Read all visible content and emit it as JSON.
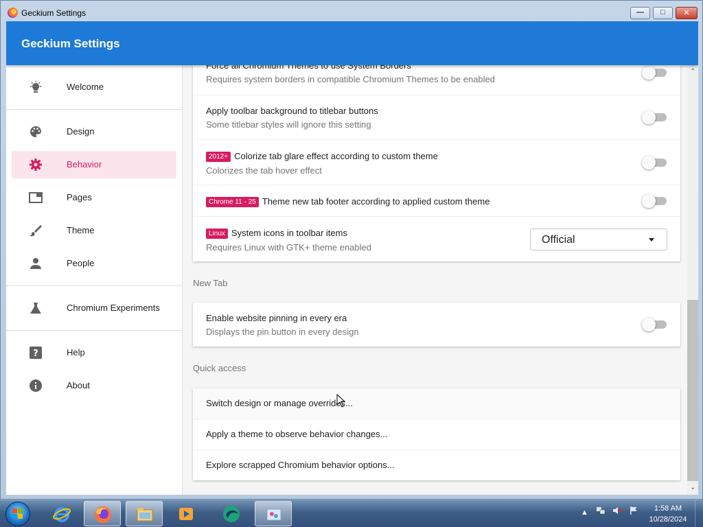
{
  "window": {
    "title": "Geckium Settings"
  },
  "app": {
    "title": "Geckium Settings"
  },
  "sidebar": {
    "items": [
      {
        "label": "Welcome",
        "icon": "lightbulb-icon"
      },
      {
        "label": "Design",
        "icon": "palette-icon"
      },
      {
        "label": "Behavior",
        "icon": "gear-icon"
      },
      {
        "label": "Pages",
        "icon": "window-icon"
      },
      {
        "label": "Theme",
        "icon": "brush-icon"
      },
      {
        "label": "People",
        "icon": "person-icon"
      },
      {
        "label": "Chromium Experiments",
        "icon": "flask-icon"
      },
      {
        "label": "Help",
        "icon": "help-icon"
      },
      {
        "label": "About",
        "icon": "info-icon"
      }
    ],
    "active": "Behavior"
  },
  "behavior_card": {
    "rows": [
      {
        "title": "Force all Chromium Themes to use System Borders",
        "subtitle": "Requires system borders in compatible Chromium Themes to be enabled",
        "toggle": false
      },
      {
        "title": "Apply toolbar background to titlebar buttons",
        "subtitle": "Some titlebar styles will ignore this setting",
        "toggle": false
      },
      {
        "tag": "2012+",
        "title": "Colorize tab glare effect according to custom theme",
        "subtitle": "Colorizes the tab hover effect",
        "toggle": false
      },
      {
        "tag": "Chrome 11 - 25",
        "title": "Theme new tab footer according to applied custom theme",
        "toggle": false
      },
      {
        "tag": "Linux",
        "title": "System icons in toolbar items",
        "subtitle": "Requires Linux with GTK+ theme enabled",
        "select_value": "Official"
      }
    ]
  },
  "new_tab": {
    "section_label": "New Tab",
    "rows": [
      {
        "title": "Enable website pinning in every era",
        "subtitle": "Displays the pin button in every design",
        "toggle": false
      }
    ]
  },
  "quick_access": {
    "section_label": "Quick access",
    "links": [
      "Switch design or manage overrides...",
      "Apply a theme to observe behavior changes...",
      "Explore scrapped Chromium behavior options..."
    ]
  },
  "taskbar": {
    "apps": [
      "internet-explorer-icon",
      "firefox-icon",
      "file-explorer-icon",
      "media-player-icon",
      "browser-icon",
      "paint-icon"
    ],
    "clock": {
      "time": "1:58 AM",
      "date": "10/28/2024"
    }
  },
  "colors": {
    "accent": "#1e7ad6",
    "active": "#d81b60",
    "active_bg": "#fce4ec"
  }
}
